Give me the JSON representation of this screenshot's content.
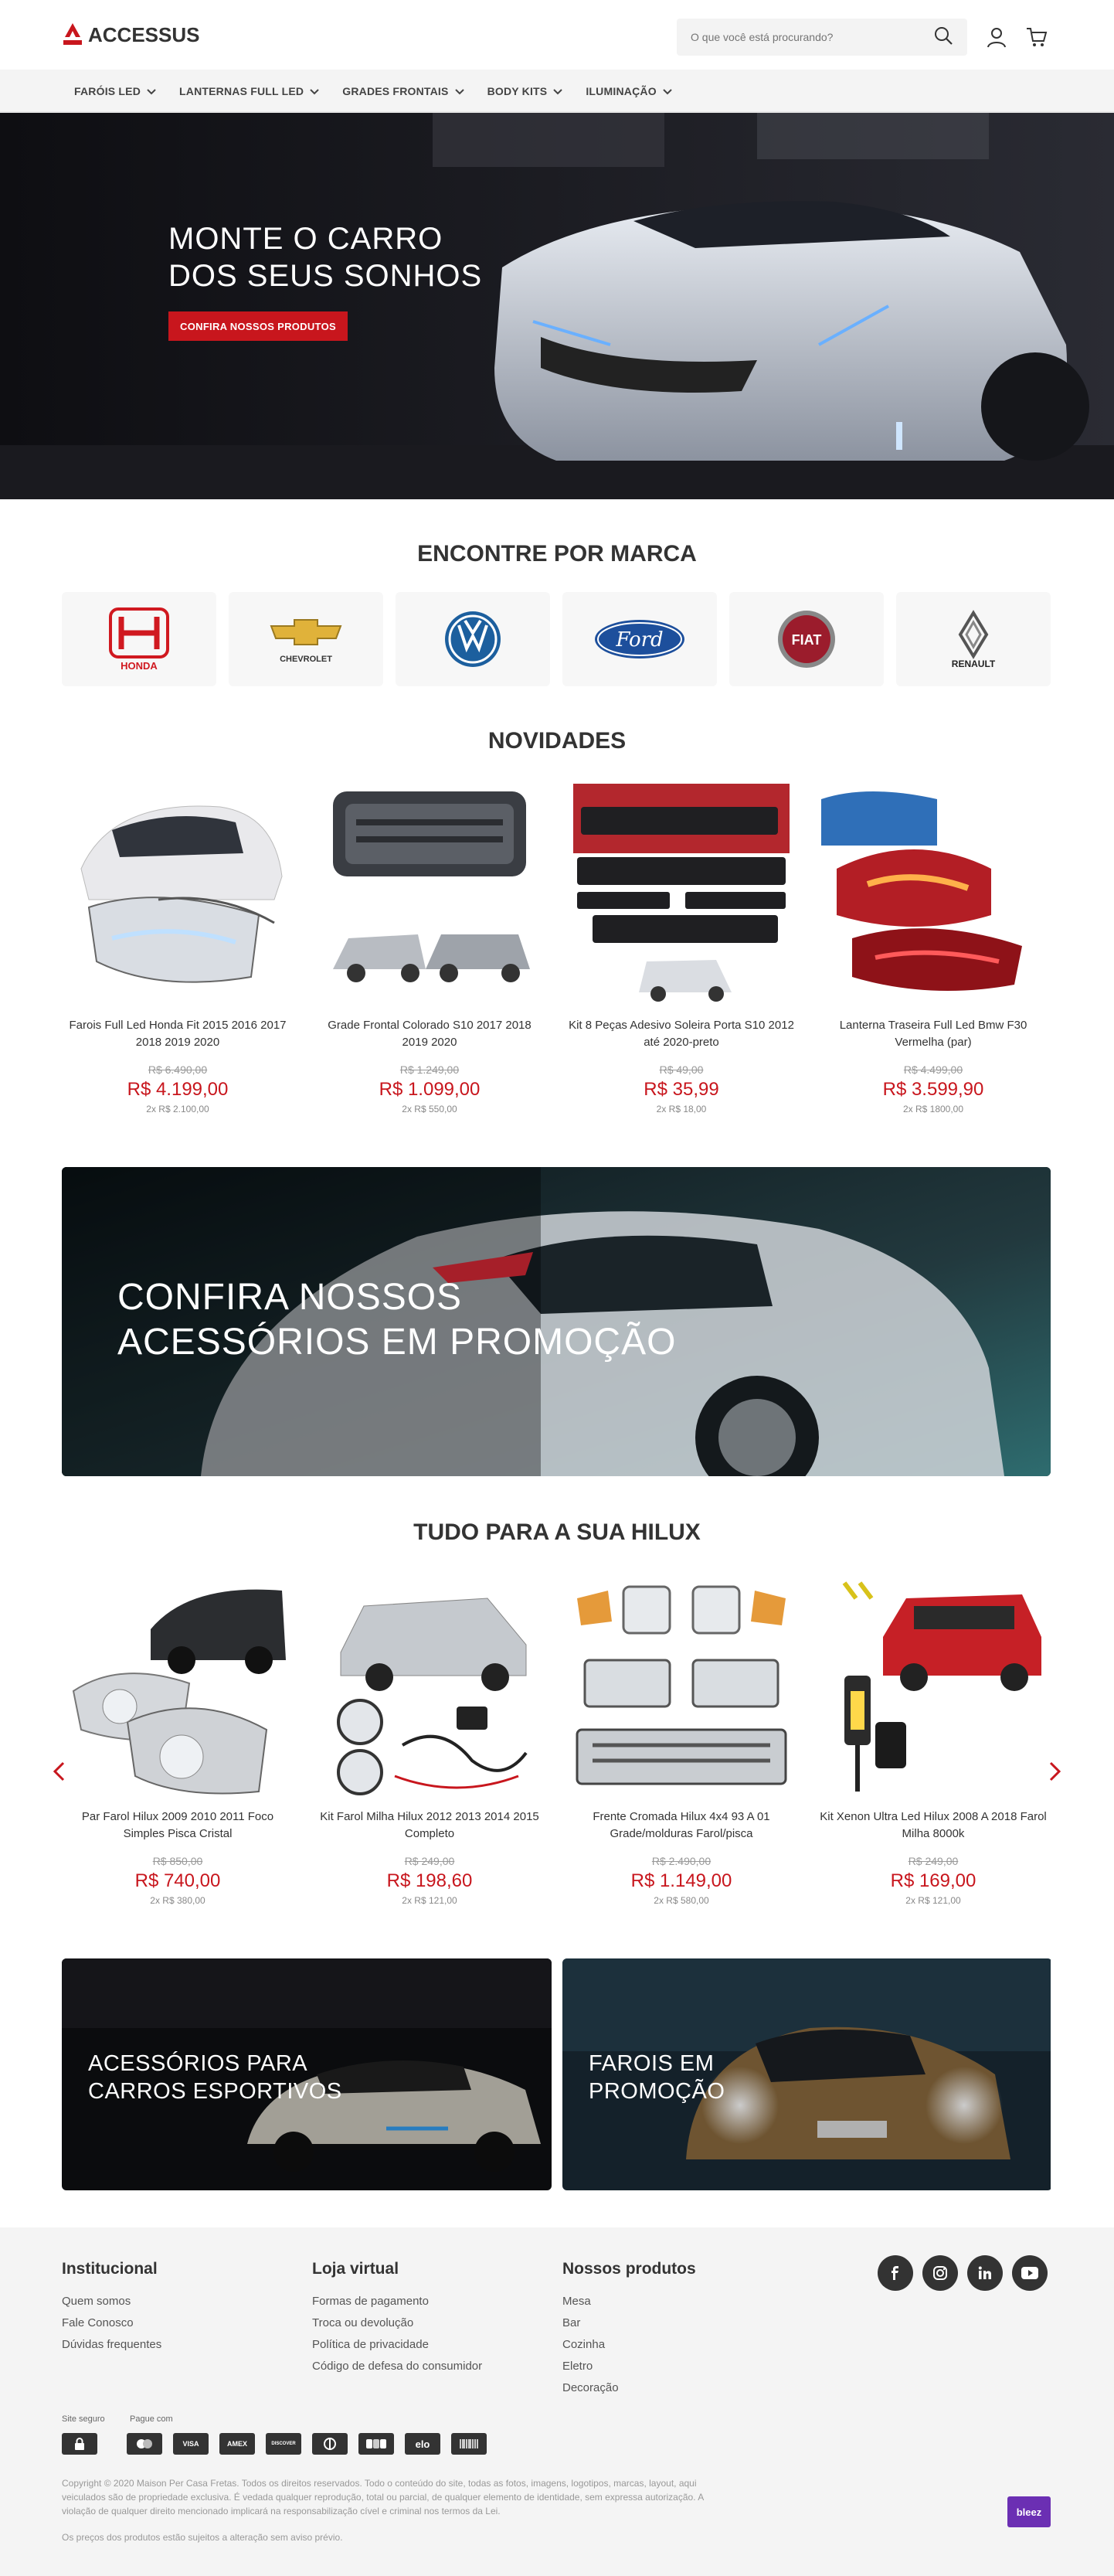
{
  "header": {
    "logo_text": "ACCESSUS",
    "search_placeholder": "O que você está procurando?",
    "icons": [
      "search-icon",
      "user-icon",
      "cart-icon"
    ]
  },
  "nav": {
    "items": [
      {
        "label": "FARÓIS LED"
      },
      {
        "label": "LANTERNAS FULL LED"
      },
      {
        "label": "GRADES FRONTAIS"
      },
      {
        "label": "BODY KITS"
      },
      {
        "label": "ILUMINAÇÃO"
      }
    ]
  },
  "hero": {
    "title_line1": "MONTE O CARRO",
    "title_line2": "DOS SEUS SONHOS",
    "button": "CONFIRA NOSSOS PRODUTOS"
  },
  "brands": {
    "title": "ENCONTRE POR MARCA",
    "items": [
      {
        "label": "HONDA"
      },
      {
        "label": "CHEVROLET"
      },
      {
        "label": "VW"
      },
      {
        "label": "Ford"
      },
      {
        "label": "FIAT"
      },
      {
        "label": "RENAULT"
      }
    ]
  },
  "novidades": {
    "title": "NOVIDADES",
    "products": [
      {
        "name": "Farois Full Led Honda Fit 2015 2016 2017 2018 2019 2020",
        "old_price": "R$ 6.490,00",
        "price": "R$ 4.199,00",
        "installments": "2x R$ 2.100,00"
      },
      {
        "name": "Grade Frontal Colorado S10 2017 2018 2019 2020",
        "old_price": "R$ 1.249,00",
        "price": "R$ 1.099,00",
        "installments": "2x R$ 550,00"
      },
      {
        "name": "Kit 8 Peças Adesivo Soleira Porta S10 2012 até 2020-preto",
        "old_price": "R$ 49,00",
        "price": "R$ 35,99",
        "installments": "2x R$ 18,00"
      },
      {
        "name": "Lanterna Traseira Full Led Bmw F30 Vermelha (par)",
        "old_price": "R$ 4.499,00",
        "price": "R$ 3.599,90",
        "installments": "2x R$ 1800,00"
      }
    ]
  },
  "promo": {
    "line1": "CONFIRA NOSSOS",
    "line2": "ACESSÓRIOS EM PROMOÇÃO"
  },
  "hilux": {
    "title": "TUDO PARA A SUA HILUX",
    "products": [
      {
        "name": "Par Farol Hilux 2009 2010 2011 Foco Simples Pisca Cristal",
        "old_price": "R$ 850,00",
        "price": "R$ 740,00",
        "installments": "2x R$ 380,00"
      },
      {
        "name": "Kit Farol Milha Hilux 2012 2013 2014 2015 Completo",
        "old_price": "R$ 249,00",
        "price": "R$ 198,60",
        "installments": "2x R$ 121,00"
      },
      {
        "name": "Frente Cromada Hilux 4x4 93 A 01 Grade/molduras Farol/pisca",
        "old_price": "R$ 2.490,00",
        "price": "R$ 1.149,00",
        "installments": "2x R$ 580,00"
      },
      {
        "name": "Kit Xenon Ultra Led Hilux 2008 A 2018 Farol Milha 8000k",
        "old_price": "R$ 249,00",
        "price": "R$ 169,00",
        "installments": "2x R$ 121,00"
      }
    ]
  },
  "banners": [
    {
      "line1": "ACESSÓRIOS PARA",
      "line2": "CARROS ESPORTIVOS"
    },
    {
      "line1": "FAROIS EM",
      "line2": "PROMOÇÃO"
    }
  ],
  "footer": {
    "col1": {
      "title": "Institucional",
      "links": [
        "Quem somos",
        "Fale Conosco",
        "Dúvidas frequentes"
      ]
    },
    "col2": {
      "title": "Loja virtual",
      "links": [
        "Formas de pagamento",
        "Troca ou devolução",
        "Política de privacidade",
        "Código de defesa do consumidor"
      ]
    },
    "col3": {
      "title": "Nossos produtos",
      "links": [
        "Mesa",
        "Bar",
        "Cozinha",
        "Eletro",
        "Decoração"
      ]
    },
    "social": [
      "facebook-icon",
      "instagram-icon",
      "linkedin-icon",
      "youtube-icon"
    ],
    "secure_label": "Site seguro",
    "pay_label": "Pague com",
    "payments": [
      "",
      "VISA",
      "AMEX",
      "DISCOVER",
      "",
      "",
      "elo",
      ""
    ],
    "copyright": "Copyright © 2020 Maison Per Casa Fretas. Todos os direitos reservados. Todo o conteúdo do site, todas as fotos, imagens, logotipos, marcas, layout, aqui veiculados são de propriedade exclusiva. É vedada qualquer reprodução, total ou parcial, de qualquer elemento de identidade, sem expressa autorização. A violação de qualquer direito mencionado implicará na responsabilização cível e criminal nos termos da Lei.",
    "notice": "Os preços dos produtos estão sujeitos a alteração sem aviso prévio.",
    "badge": "bleez"
  },
  "colors": {
    "accent": "#c8161d",
    "nav_bg": "#f4f4f4",
    "footer_bg": "#f4f4f4",
    "dark": "#333333"
  }
}
